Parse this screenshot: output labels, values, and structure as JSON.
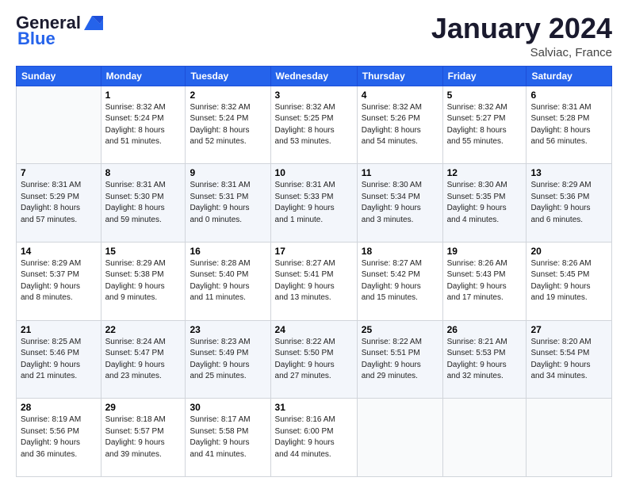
{
  "header": {
    "logo_line1": "General",
    "logo_line2": "Blue",
    "month_title": "January 2024",
    "location": "Salviac, France"
  },
  "weekdays": [
    "Sunday",
    "Monday",
    "Tuesday",
    "Wednesday",
    "Thursday",
    "Friday",
    "Saturday"
  ],
  "weeks": [
    [
      {
        "day": null,
        "info": null
      },
      {
        "day": "1",
        "info": "Sunrise: 8:32 AM\nSunset: 5:24 PM\nDaylight: 8 hours\nand 51 minutes."
      },
      {
        "day": "2",
        "info": "Sunrise: 8:32 AM\nSunset: 5:24 PM\nDaylight: 8 hours\nand 52 minutes."
      },
      {
        "day": "3",
        "info": "Sunrise: 8:32 AM\nSunset: 5:25 PM\nDaylight: 8 hours\nand 53 minutes."
      },
      {
        "day": "4",
        "info": "Sunrise: 8:32 AM\nSunset: 5:26 PM\nDaylight: 8 hours\nand 54 minutes."
      },
      {
        "day": "5",
        "info": "Sunrise: 8:32 AM\nSunset: 5:27 PM\nDaylight: 8 hours\nand 55 minutes."
      },
      {
        "day": "6",
        "info": "Sunrise: 8:31 AM\nSunset: 5:28 PM\nDaylight: 8 hours\nand 56 minutes."
      }
    ],
    [
      {
        "day": "7",
        "info": "Sunrise: 8:31 AM\nSunset: 5:29 PM\nDaylight: 8 hours\nand 57 minutes."
      },
      {
        "day": "8",
        "info": "Sunrise: 8:31 AM\nSunset: 5:30 PM\nDaylight: 8 hours\nand 59 minutes."
      },
      {
        "day": "9",
        "info": "Sunrise: 8:31 AM\nSunset: 5:31 PM\nDaylight: 9 hours\nand 0 minutes."
      },
      {
        "day": "10",
        "info": "Sunrise: 8:31 AM\nSunset: 5:33 PM\nDaylight: 9 hours\nand 1 minute."
      },
      {
        "day": "11",
        "info": "Sunrise: 8:30 AM\nSunset: 5:34 PM\nDaylight: 9 hours\nand 3 minutes."
      },
      {
        "day": "12",
        "info": "Sunrise: 8:30 AM\nSunset: 5:35 PM\nDaylight: 9 hours\nand 4 minutes."
      },
      {
        "day": "13",
        "info": "Sunrise: 8:29 AM\nSunset: 5:36 PM\nDaylight: 9 hours\nand 6 minutes."
      }
    ],
    [
      {
        "day": "14",
        "info": "Sunrise: 8:29 AM\nSunset: 5:37 PM\nDaylight: 9 hours\nand 8 minutes."
      },
      {
        "day": "15",
        "info": "Sunrise: 8:29 AM\nSunset: 5:38 PM\nDaylight: 9 hours\nand 9 minutes."
      },
      {
        "day": "16",
        "info": "Sunrise: 8:28 AM\nSunset: 5:40 PM\nDaylight: 9 hours\nand 11 minutes."
      },
      {
        "day": "17",
        "info": "Sunrise: 8:27 AM\nSunset: 5:41 PM\nDaylight: 9 hours\nand 13 minutes."
      },
      {
        "day": "18",
        "info": "Sunrise: 8:27 AM\nSunset: 5:42 PM\nDaylight: 9 hours\nand 15 minutes."
      },
      {
        "day": "19",
        "info": "Sunrise: 8:26 AM\nSunset: 5:43 PM\nDaylight: 9 hours\nand 17 minutes."
      },
      {
        "day": "20",
        "info": "Sunrise: 8:26 AM\nSunset: 5:45 PM\nDaylight: 9 hours\nand 19 minutes."
      }
    ],
    [
      {
        "day": "21",
        "info": "Sunrise: 8:25 AM\nSunset: 5:46 PM\nDaylight: 9 hours\nand 21 minutes."
      },
      {
        "day": "22",
        "info": "Sunrise: 8:24 AM\nSunset: 5:47 PM\nDaylight: 9 hours\nand 23 minutes."
      },
      {
        "day": "23",
        "info": "Sunrise: 8:23 AM\nSunset: 5:49 PM\nDaylight: 9 hours\nand 25 minutes."
      },
      {
        "day": "24",
        "info": "Sunrise: 8:22 AM\nSunset: 5:50 PM\nDaylight: 9 hours\nand 27 minutes."
      },
      {
        "day": "25",
        "info": "Sunrise: 8:22 AM\nSunset: 5:51 PM\nDaylight: 9 hours\nand 29 minutes."
      },
      {
        "day": "26",
        "info": "Sunrise: 8:21 AM\nSunset: 5:53 PM\nDaylight: 9 hours\nand 32 minutes."
      },
      {
        "day": "27",
        "info": "Sunrise: 8:20 AM\nSunset: 5:54 PM\nDaylight: 9 hours\nand 34 minutes."
      }
    ],
    [
      {
        "day": "28",
        "info": "Sunrise: 8:19 AM\nSunset: 5:56 PM\nDaylight: 9 hours\nand 36 minutes."
      },
      {
        "day": "29",
        "info": "Sunrise: 8:18 AM\nSunset: 5:57 PM\nDaylight: 9 hours\nand 39 minutes."
      },
      {
        "day": "30",
        "info": "Sunrise: 8:17 AM\nSunset: 5:58 PM\nDaylight: 9 hours\nand 41 minutes."
      },
      {
        "day": "31",
        "info": "Sunrise: 8:16 AM\nSunset: 6:00 PM\nDaylight: 9 hours\nand 44 minutes."
      },
      {
        "day": null,
        "info": null
      },
      {
        "day": null,
        "info": null
      },
      {
        "day": null,
        "info": null
      }
    ]
  ]
}
